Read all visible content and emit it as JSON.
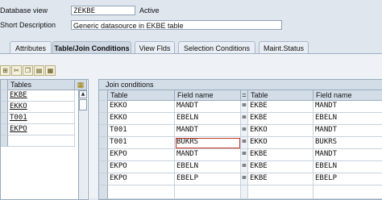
{
  "header": {
    "database_view_label": "Database view",
    "database_view_value": "ZEKBE",
    "database_view_status": "Active",
    "short_description_label": "Short Description",
    "short_description_value": "Generic datasource in EKBE table"
  },
  "tabs": [
    {
      "label": "Attributes"
    },
    {
      "label": "Table/Join Conditions"
    },
    {
      "label": "View Flds"
    },
    {
      "label": "Selection Conditions"
    },
    {
      "label": "Maint.Status"
    }
  ],
  "active_tab": "Table/Join Conditions",
  "tables": {
    "header": "Tables",
    "rows": [
      "EKBE",
      "EKKO",
      "T001",
      "EKPO"
    ]
  },
  "joins": {
    "title": "Join conditions",
    "columns": [
      "Table",
      "Field name",
      "=",
      "Table",
      "Field name"
    ],
    "rows": [
      {
        "t1": "EKKO",
        "f1": "MANDT",
        "op": "=",
        "t2": "EKBE",
        "f2": "MANDT"
      },
      {
        "t1": "EKKO",
        "f1": "EBELN",
        "op": "=",
        "t2": "EKBE",
        "f2": "EBELN"
      },
      {
        "t1": "T001",
        "f1": "MANDT",
        "op": "=",
        "t2": "EKKO",
        "f2": "MANDT"
      },
      {
        "t1": "T001",
        "f1": "BUKRS",
        "op": "=",
        "t2": "EKKO",
        "f2": "BUKRS"
      },
      {
        "t1": "EKPO",
        "f1": "MANDT",
        "op": "=",
        "t2": "EKBE",
        "f2": "MANDT"
      },
      {
        "t1": "EKPO",
        "f1": "EBELN",
        "op": "=",
        "t2": "EKBE",
        "f2": "EBELN"
      },
      {
        "t1": "EKPO",
        "f1": "EBELP",
        "op": "=",
        "t2": "EKBE",
        "f2": "EBELP"
      }
    ]
  }
}
